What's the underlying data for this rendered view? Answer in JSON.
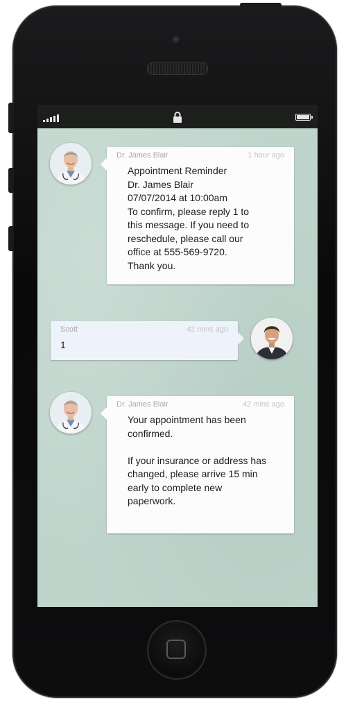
{
  "status_bar": {
    "signal_icon": "signal-bars-icon",
    "lock_icon": "lock-icon",
    "battery_icon": "battery-icon"
  },
  "messages": [
    {
      "sender": "Dr. James Blair",
      "time": "1 hour ago",
      "body": "Appointment Reminder\nDr. James Blair\n07/07/2014 at 10:00am\nTo confirm, please reply 1 to\nthis message.  If you need to\nreschedule, please call our\noffice at 555-569-9720.\nThank you."
    },
    {
      "sender": "Scott",
      "time": "42 mins ago",
      "body": "1"
    },
    {
      "sender": "Dr. James Blair",
      "time": "42 mins ago",
      "body": "Your appointment has been\nconfirmed.\n\nIf your insurance or address has\nchanged,  please arrive 15 min\nearly to complete new\npaperwork."
    }
  ],
  "colors": {
    "screen_background": "#bfd5cc",
    "received_bubble": "#fcfcfc",
    "sent_bubble": "#eef3fb"
  }
}
